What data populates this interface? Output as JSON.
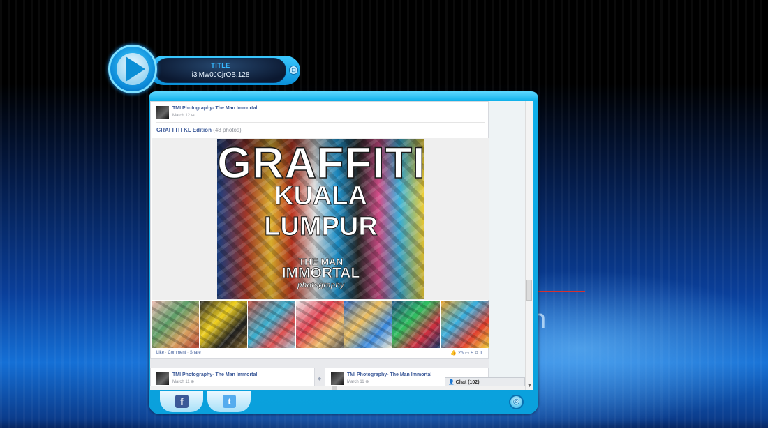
{
  "player": {
    "title_label": "TITLE",
    "title_value": "i3lMw0JCjrOB.128"
  },
  "post": {
    "author": "TMI Photography- The Man Immortal",
    "date": "March 12",
    "album_title": "GRAFFITI KL Edition",
    "album_count": "(48 photos)",
    "cover_text": {
      "line1": "GRAFFITI",
      "line2": "KUALA LUMPUR",
      "line3": "THE MAN",
      "line4": "IMMORTAL",
      "line5": "photography"
    },
    "actions": {
      "like": "Like",
      "comment": "Comment",
      "share": "Share",
      "separator": "·"
    },
    "counts": {
      "likes": "26",
      "comments": "9",
      "shares": "1"
    }
  },
  "next_posts": [
    {
      "author": "TMI Photography- The Man Immortal",
      "date": "March 11"
    },
    {
      "author": "TMI Photography- The Man Immortal",
      "date": "March 11"
    }
  ],
  "chat": {
    "label": "Chat",
    "count": "(102)"
  },
  "icons": {
    "play": "play-icon",
    "facebook": "facebook-icon",
    "twitter": "twitter-icon",
    "menu": "menu-icon"
  },
  "colors": {
    "accent": "#0fb0ea",
    "fb_link": "#3b5998",
    "facebook": "#3b5998",
    "twitter": "#55acee"
  }
}
